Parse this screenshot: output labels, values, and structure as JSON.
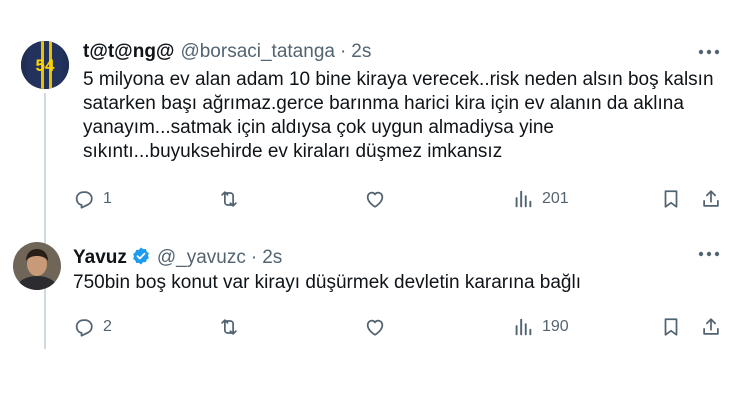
{
  "tweets": [
    {
      "display_name": "t@t@ng@",
      "handle": "@borsaci_tatanga",
      "separator": "·",
      "time": "2s",
      "avatar_text": "54",
      "lines": [
        "5 milyona ev alan adam 10 bine kiraya verecek..risk neden alsın boş kalsın",
        "satarken başı ağrımaz.gerce barınma harici kira için ev alanın da aklına",
        "yanayım...satmak için aldıysa çok uygun almadiysa yine",
        "sıkıntı...buyuksehirde ev kiraları düşmez imkansız"
      ],
      "replies": "1",
      "views": "201"
    },
    {
      "display_name": "Yavuz",
      "handle": "@_yavuzc",
      "separator": "·",
      "time": "2s",
      "lines": [
        "750bin boş konut var kirayı düşürmek devletin kararına bağlı"
      ],
      "replies": "2",
      "views": "190"
    }
  ],
  "colors": {
    "text": "#0f1419",
    "secondary": "#536471",
    "verified": "#1d9bf0",
    "thread_line": "#cfd9de"
  },
  "icons": [
    "more-icon",
    "reply-icon",
    "retweet-icon",
    "like-icon",
    "views-icon",
    "bookmark-icon",
    "share-icon",
    "verified-icon"
  ]
}
